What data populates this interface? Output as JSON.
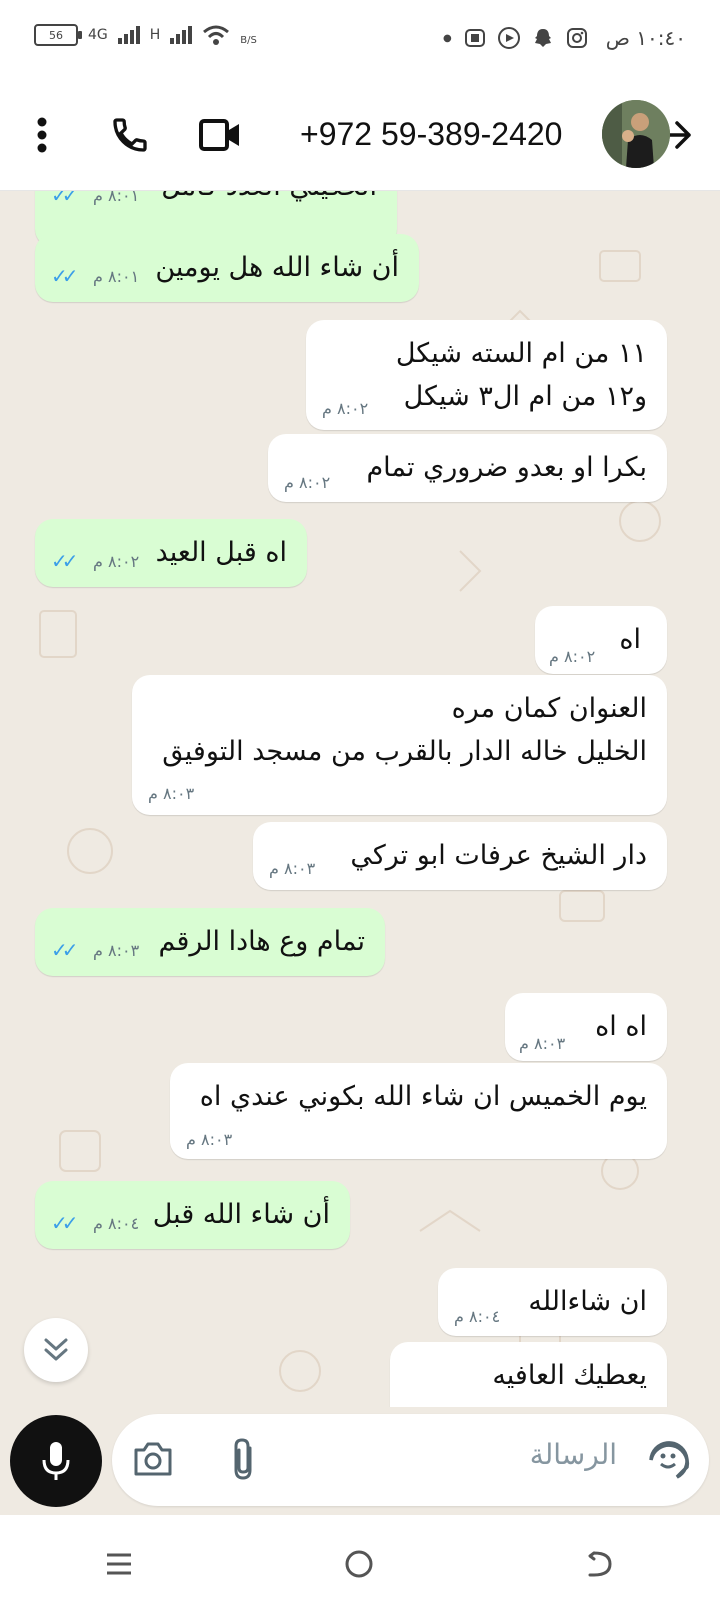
{
  "status_bar": {
    "battery": "56",
    "network1": "4G",
    "network2": "H",
    "speed": "B/S",
    "time": "١٠:٤٠ ص"
  },
  "header": {
    "title": "+972 59-389-2420"
  },
  "messages": [
    {
      "text": "الحكيلي العدد كامل",
      "time": "٨:٠١ م"
    },
    {
      "text": "أن شاء الله هل يومين",
      "time": "٨:٠١ م"
    },
    {
      "line1": "١١ من ام السته شيكل",
      "line2": "و١٢ من ام ال٣ شيكل",
      "time": "٨:٠٢ م"
    },
    {
      "text": "بكرا او بعدو ضروري تمام",
      "time": "٨:٠٢ م"
    },
    {
      "text": "اه قبل العيد",
      "time": "٨:٠٢ م"
    },
    {
      "text": "اه",
      "time": "٨:٠٢ م"
    },
    {
      "line1": "العنوان كمان مره",
      "line2": "الخليل خاله الدار بالقرب من مسجد التوفيق",
      "time": "٨:٠٣ م"
    },
    {
      "text": "دار الشيخ عرفات ابو تركي",
      "time": "٨:٠٣ م"
    },
    {
      "text": "تمام وع هادا الرقم",
      "time": "٨:٠٣ م"
    },
    {
      "text": "اه اه",
      "time": "٨:٠٣ م"
    },
    {
      "text": "يوم الخميس ان شاء الله بكوني عندي اه",
      "time": "٨:٠٣ م"
    },
    {
      "text": "أن شاء الله قبل",
      "time": "٨:٠٤ م"
    },
    {
      "text": "ان شاءالله",
      "time": "٨:٠٤ م"
    },
    {
      "text": "يعطيك العافيه"
    }
  ],
  "input": {
    "placeholder": "الرسالة"
  },
  "colors": {
    "outgoing": "#d9fdd3",
    "incoming": "#ffffff",
    "ticks": "#3b9ee8",
    "background": "#efeae2"
  }
}
